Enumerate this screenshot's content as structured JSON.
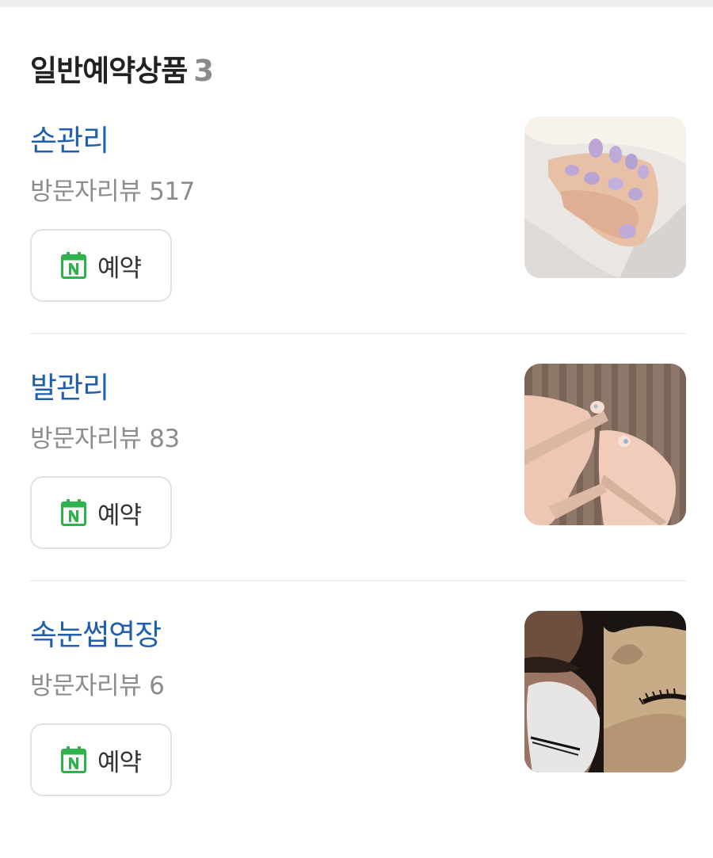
{
  "section": {
    "title": "일반예약상품",
    "count": "3"
  },
  "items": [
    {
      "title": "손관리",
      "review_label": "방문자리뷰",
      "review_count": "517",
      "button_label": "예약",
      "image_icon": "nail-photo"
    },
    {
      "title": "발관리",
      "review_label": "방문자리뷰",
      "review_count": "83",
      "button_label": "예약",
      "image_icon": "pedicure-photo"
    },
    {
      "title": "속눈썹연장",
      "review_label": "방문자리뷰",
      "review_count": "6",
      "button_label": "예약",
      "image_icon": "eyelash-photo"
    }
  ],
  "colors": {
    "accent_title": "#1f5fae",
    "booking_icon_green": "#2db34a",
    "review_gray": "#8c8c8c"
  }
}
